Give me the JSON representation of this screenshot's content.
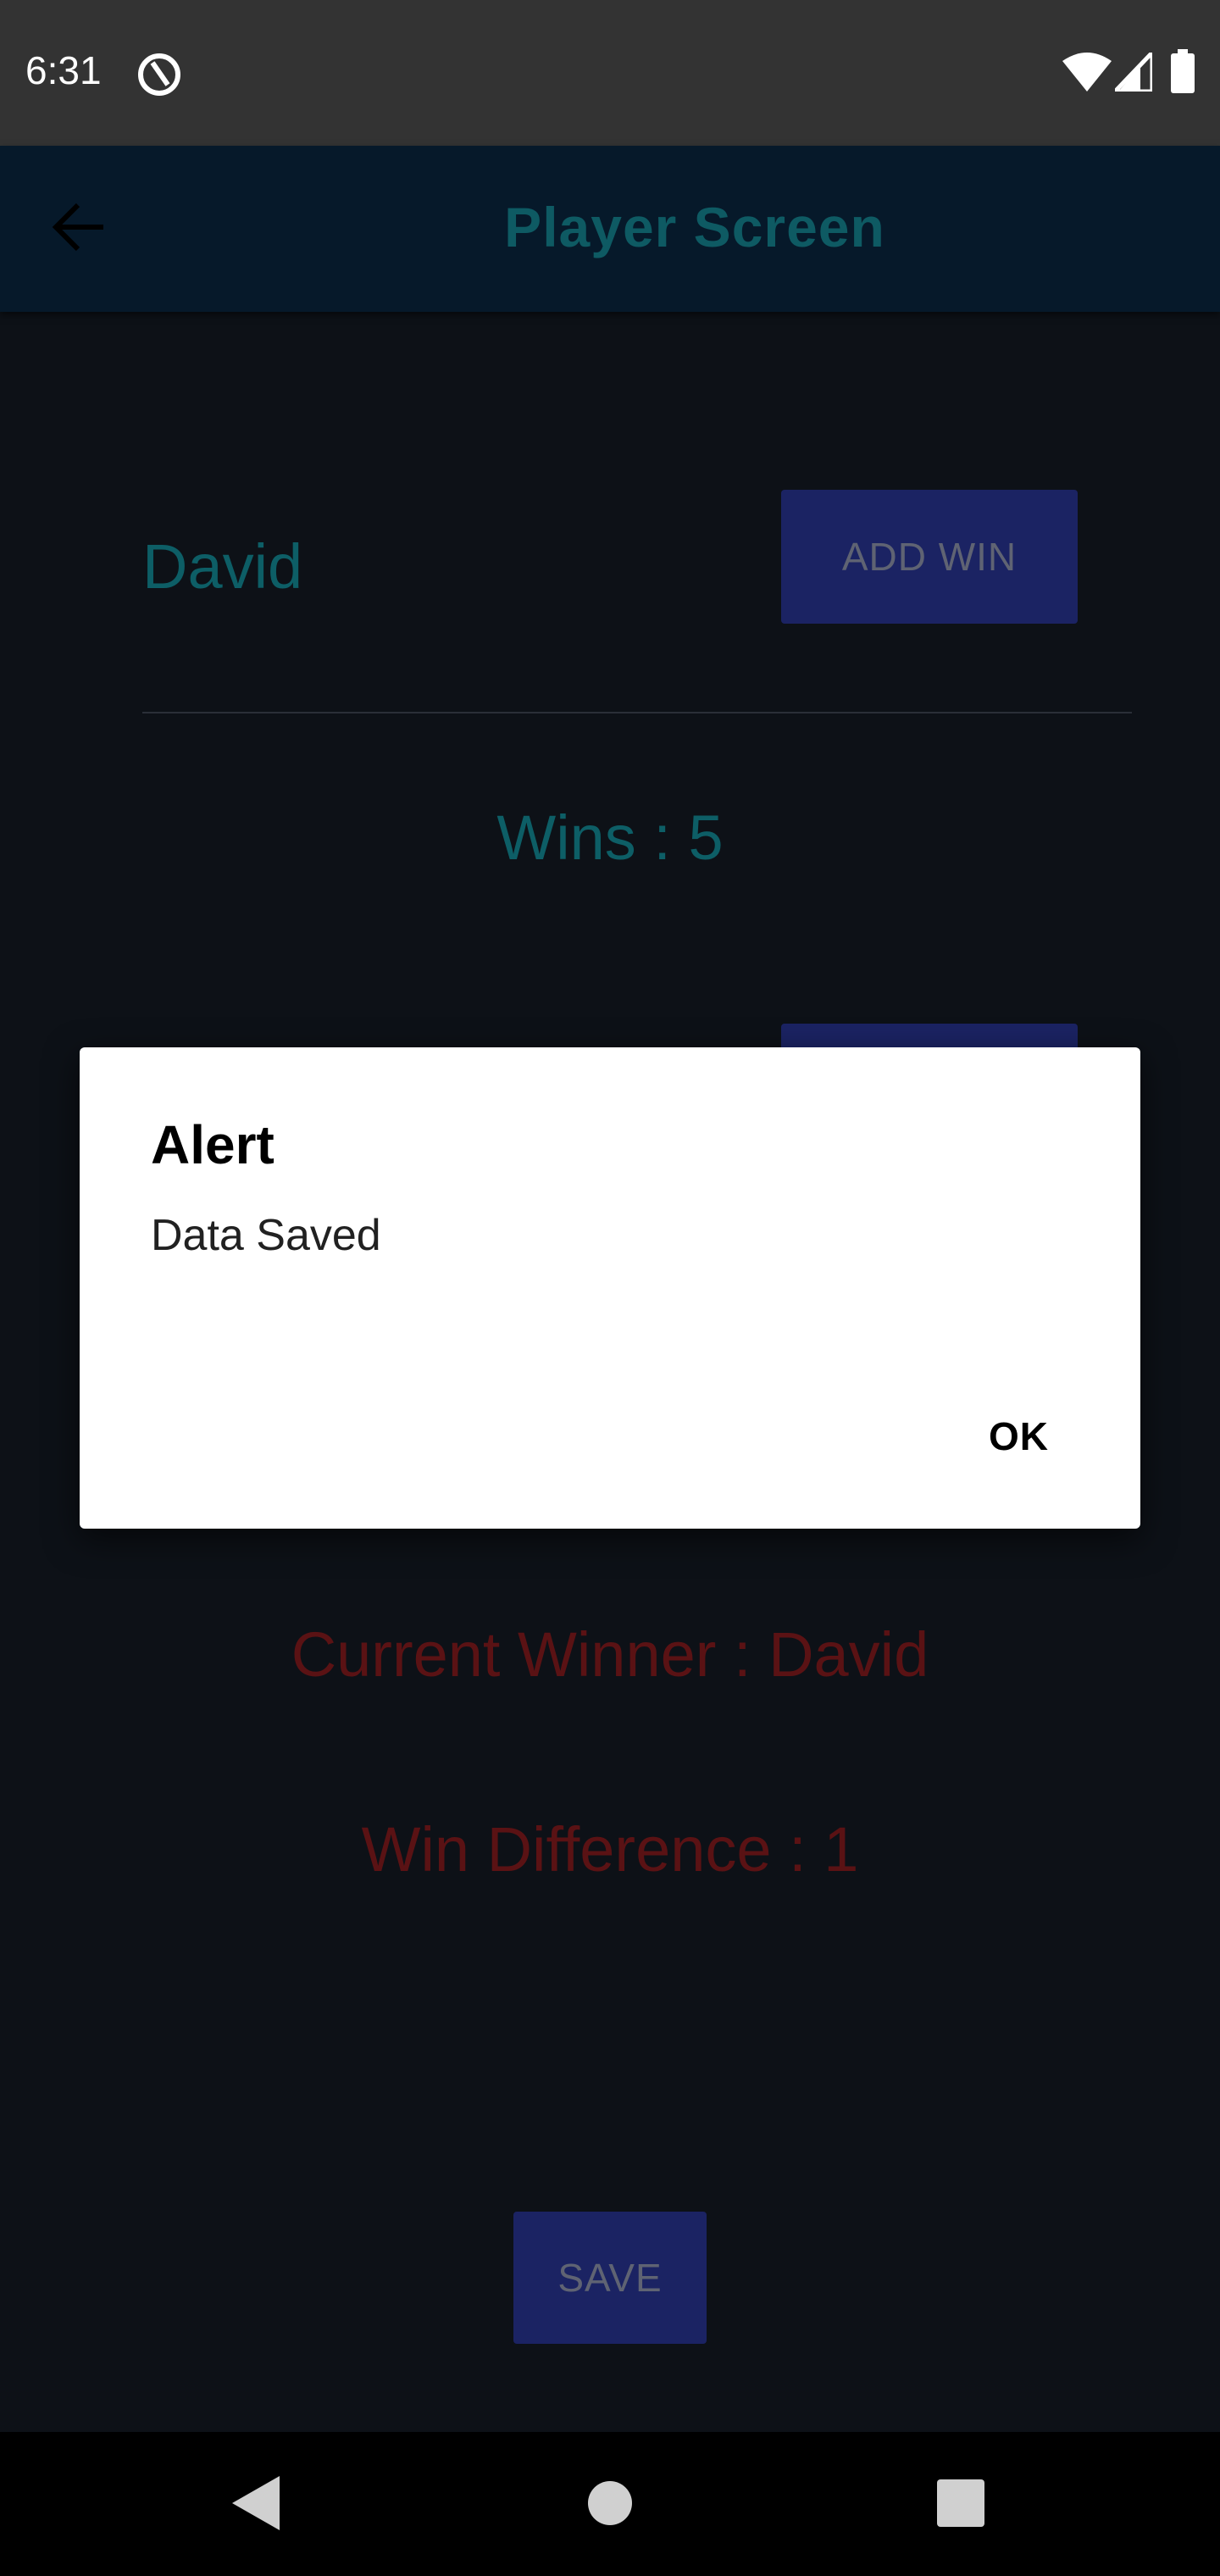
{
  "status_bar": {
    "time": "6:31"
  },
  "app_bar": {
    "title": "Player Screen"
  },
  "player": {
    "name": "David",
    "add_win_label": "ADD WIN",
    "wins_text": "Wins : 5"
  },
  "summary": {
    "current_winner_text": "Current Winner : David",
    "win_difference_text": "Win Difference : 1"
  },
  "actions": {
    "save_label": "SAVE"
  },
  "dialog": {
    "title": "Alert",
    "message": "Data Saved",
    "ok_label": "OK"
  },
  "colors": {
    "background": "#0d1117",
    "app_bar": "#06192a",
    "accent_teal": "#0d5e66",
    "button": "#1b2363",
    "winner_red": "#5a1214"
  },
  "icons": {
    "status": [
      "blocked-icon",
      "wifi-icon",
      "signal-icon",
      "battery-icon"
    ],
    "app_bar": "back-arrow-icon",
    "nav": [
      "back-triangle-icon",
      "home-circle-icon",
      "recents-square-icon"
    ]
  }
}
